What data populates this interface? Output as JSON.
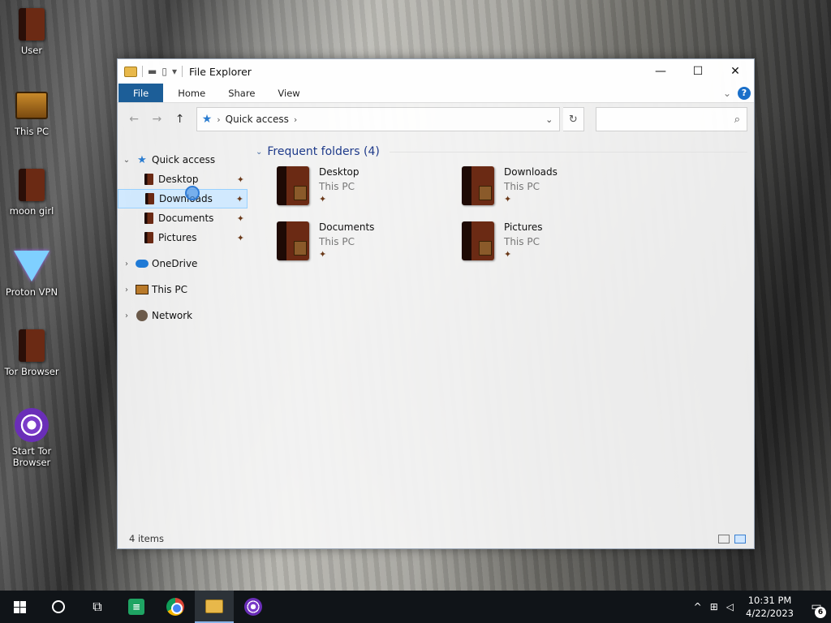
{
  "desktop": {
    "icons": [
      {
        "label": "User",
        "icon": "folder-book-icon"
      },
      {
        "label": "This PC",
        "icon": "computer-icon"
      },
      {
        "label": "moon girl",
        "icon": "folder-book-icon"
      },
      {
        "label": "Proton VPN",
        "icon": "proton-vpn-icon"
      },
      {
        "label": "Tor Browser",
        "icon": "folder-book-icon"
      },
      {
        "label": "Start Tor Browser",
        "icon": "tor-icon"
      }
    ]
  },
  "window": {
    "title": "File Explorer",
    "controls": {
      "minimize": "—",
      "maximize": "☐",
      "close": "✕"
    },
    "ribbon": {
      "tabs": [
        "File",
        "Home",
        "Share",
        "View"
      ],
      "expand": "⌄",
      "help": "?"
    },
    "address": {
      "back": "←",
      "forward": "→",
      "up": "↑",
      "chevron": "›",
      "breadcrumb": "Quick access",
      "dropdown": "⌄",
      "refresh": "↻",
      "search_icon": "⌕"
    },
    "nav": {
      "quick_access": "Quick access",
      "pinned": [
        "Desktop",
        "Downloads",
        "Documents",
        "Pictures"
      ],
      "selected": "Downloads",
      "groups": [
        "OneDrive",
        "This PC",
        "Network"
      ],
      "expand_open": "⌄",
      "expand_closed": "›"
    },
    "content": {
      "group_title": "Frequent folders (4)",
      "group_arrow": "⌄",
      "folders": [
        {
          "name": "Desktop",
          "location": "This PC"
        },
        {
          "name": "Downloads",
          "location": "This PC"
        },
        {
          "name": "Documents",
          "location": "This PC"
        },
        {
          "name": "Pictures",
          "location": "This PC"
        }
      ]
    },
    "status": {
      "item_count": "4 items"
    }
  },
  "taskbar": {
    "time": "10:31 PM",
    "date": "4/22/2023",
    "tray": {
      "chevron": "^",
      "network": "⊞",
      "volume": "◁"
    },
    "notifications": {
      "glyph": "▭",
      "count": "6"
    },
    "apps": [
      "start",
      "search",
      "task-view",
      "sheets",
      "chrome",
      "file-explorer",
      "tor-browser"
    ],
    "active_app": "file-explorer",
    "sheets_glyph": "≡"
  },
  "colors": {
    "ribbon_file": "#1c5e98",
    "group_header": "#1e3a8a",
    "selection": "#cde8ff",
    "taskbar": "#101418"
  }
}
